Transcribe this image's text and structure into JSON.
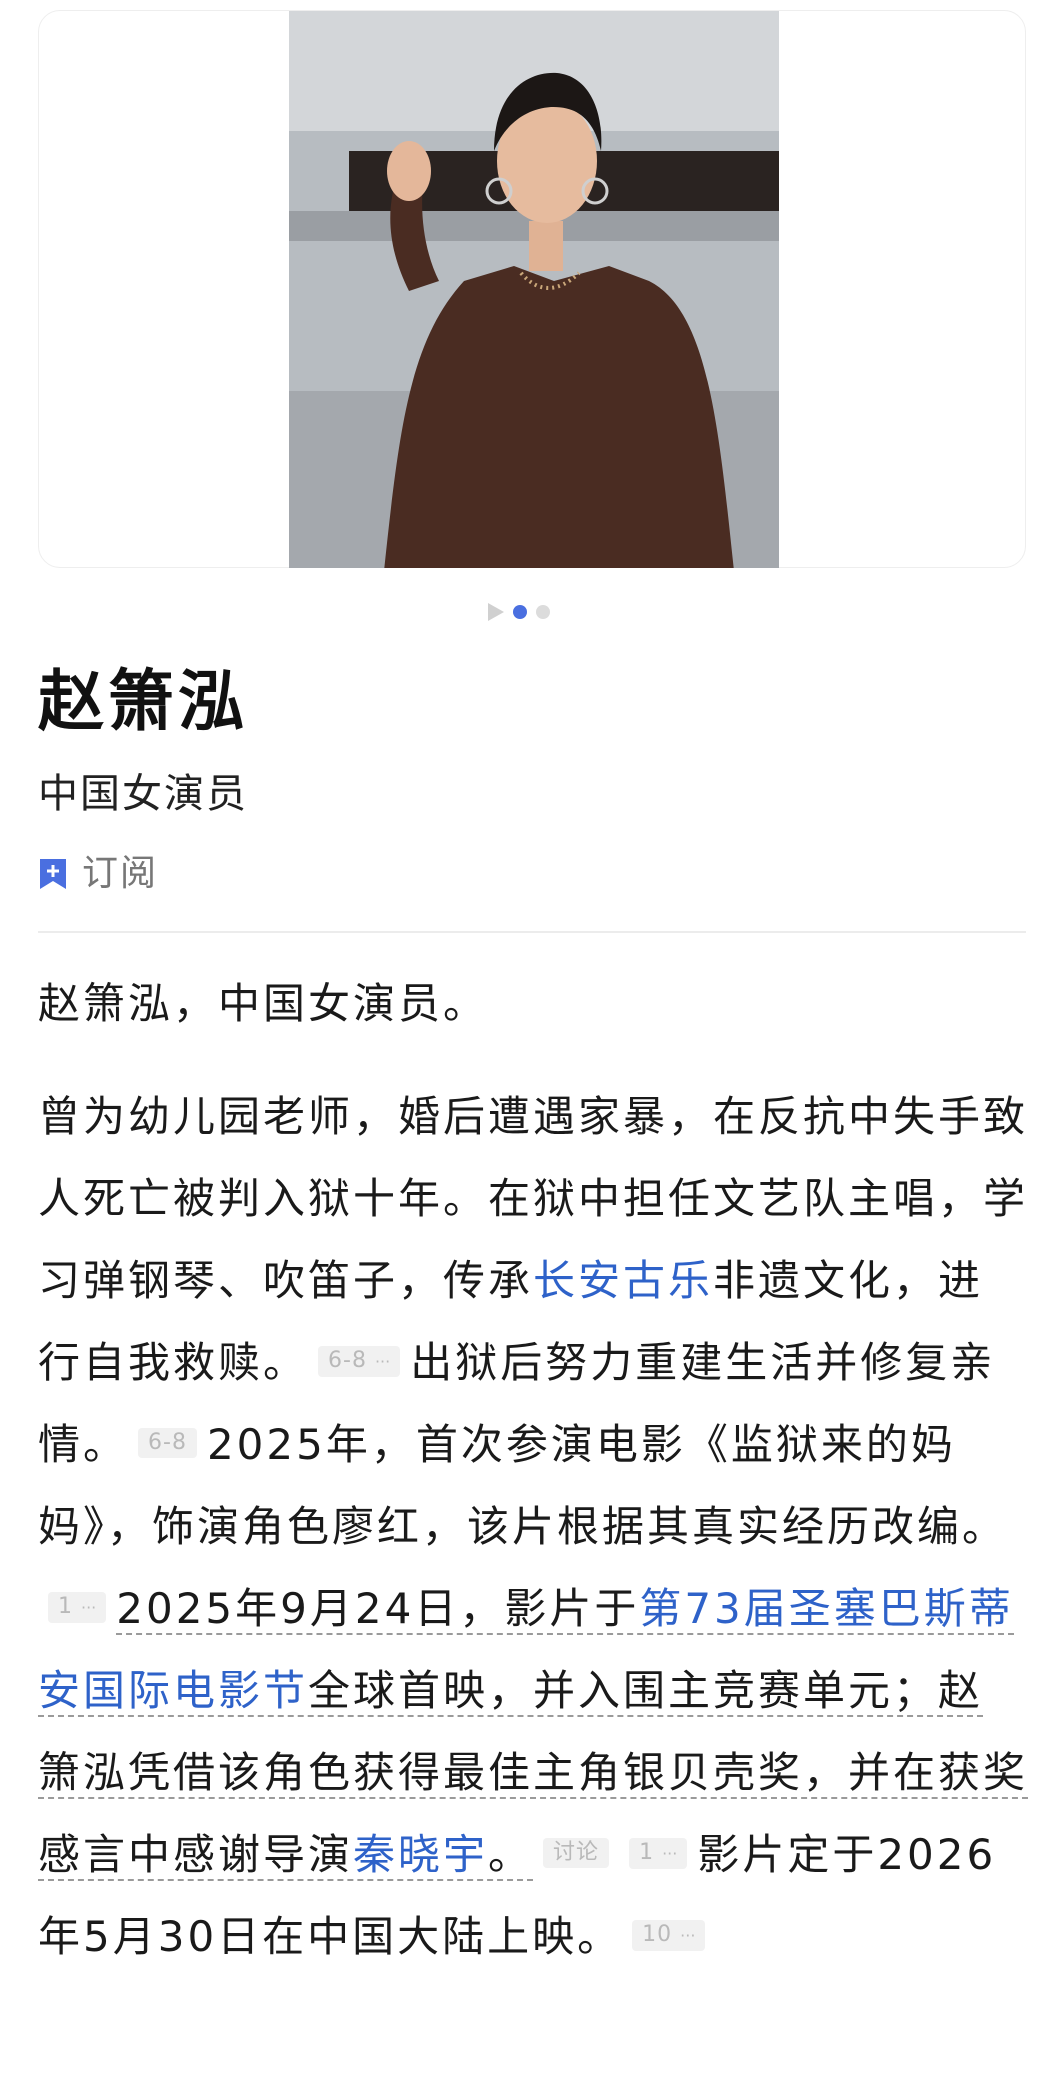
{
  "gallery": {
    "total_slides": 2,
    "active_slide": 1
  },
  "person": {
    "name": "赵箫泓",
    "subtitle": "中国女演员"
  },
  "subscribe": {
    "label": "订阅",
    "icon": "bookmark-add-icon"
  },
  "summary": "赵箫泓，中国女演员。",
  "body": {
    "s1": "曾为幼儿园老师，婚后遭遇家暴，在反抗中失手致人死亡被判入狱十年。在狱中担任文艺队主唱，学习弹钢琴、吹笛子，传承",
    "link1": "长安古乐",
    "s2": "非遗文化，进行自我救赎。",
    "cite1": "6-8",
    "s3": "出狱后努力重建生活并修复亲情。",
    "cite2": "6-8",
    "s4": "2025年，首次参演电影《监狱来的妈妈》，饰演角色廖红，该片根据其真实经历改编。",
    "cite3": "1",
    "s5": "2025年9月24日，影片于",
    "link2": "第73届圣塞巴斯蒂安国际电影节",
    "s6": "全球首映，并入围主竞赛单元；赵箫泓凭借该角色获得最佳主角银贝壳奖，并在获奖感言中感谢导演",
    "link3": "秦晓宇",
    "s7": "。",
    "discuss": "讨论",
    "cite4": "1",
    "s8": "影片定于2026年5月30日在中国大陆上映。",
    "cite5": "10",
    "more_glyph": "···"
  },
  "colors": {
    "link": "#2e62c9",
    "active_dot": "#4a6fe0",
    "subscribe_icon": "#4a6fe0"
  }
}
